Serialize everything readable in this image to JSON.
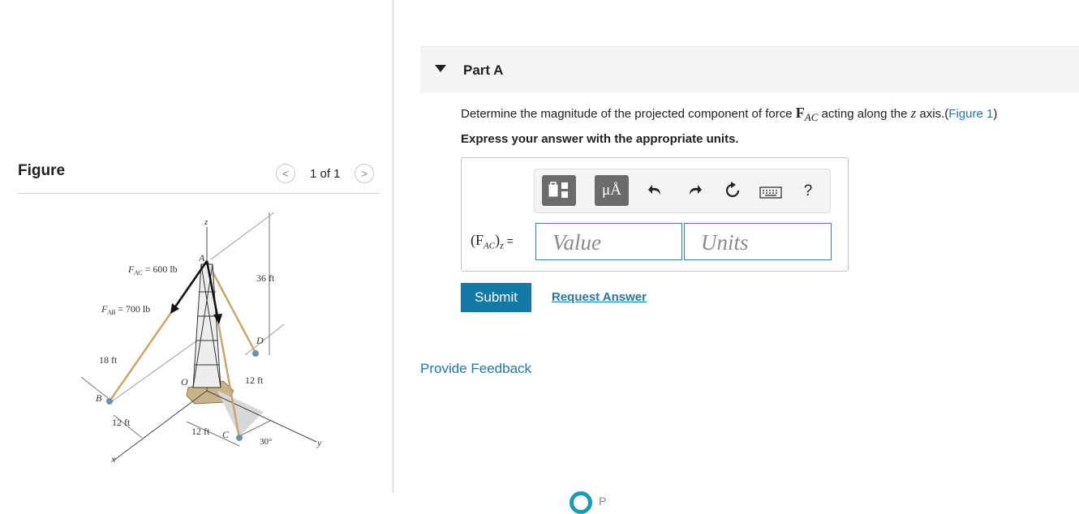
{
  "figure": {
    "title": "Figure",
    "pager": {
      "text": "1 of 1",
      "prev": "<",
      "next": ">"
    },
    "labels": {
      "fac": "F",
      "fac_sub": "AC",
      "fac_val": " = 600 lb",
      "fab": "F",
      "fab_sub": "AB",
      "fab_val": " = 700 lb",
      "z": "z",
      "a": "A",
      "h36": "36 ft",
      "d": "D",
      "h18": "18 ft",
      "o": "O",
      "h12a": "12 ft",
      "b": "B",
      "h12b": "12 ft",
      "h12c": "12 ft",
      "c": "C",
      "angle": "30°",
      "x": "x",
      "y": "y"
    }
  },
  "part": {
    "label": "Part A"
  },
  "question": {
    "pre": "Determine the magnitude of the projected component of force ",
    "bold_f": "F",
    "bold_sub": "AC",
    "mid": " acting along the ",
    "axis": "z",
    "post": " axis.(",
    "link": "Figure 1",
    "close": ")"
  },
  "express": "Express your answer with the appropriate units.",
  "toolbar": {
    "units_btn": "μÅ",
    "help": "?"
  },
  "answer": {
    "lhs_main": "(F",
    "lhs_sub": "AC",
    "lhs_close": ")",
    "lhs_z": "z",
    "lhs_eq": " =",
    "value_placeholder": "Value",
    "units_placeholder": "Units"
  },
  "actions": {
    "submit": "Submit",
    "request": "Request Answer"
  },
  "feedback": "Provide Feedback",
  "footer_partial": "P"
}
